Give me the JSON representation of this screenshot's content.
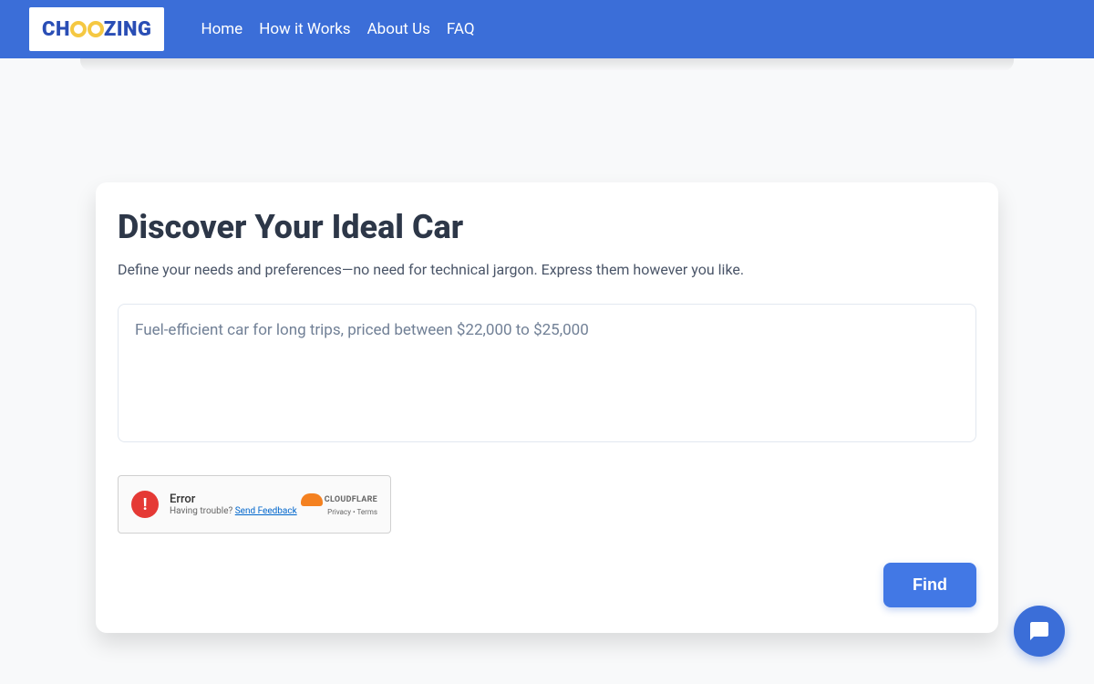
{
  "logo": {
    "part1": "CH",
    "part2": "ZING"
  },
  "nav": {
    "home": "Home",
    "how_it_works": "How it Works",
    "about_us": "About Us",
    "faq": "FAQ"
  },
  "card": {
    "title": "Discover Your Ideal Car",
    "subtitle": "Define your needs and preferences—no need for technical jargon. Express them however you like.",
    "placeholder": "Fuel-efficient car for long trips, priced between $22,000 to $25,000"
  },
  "captcha": {
    "error_label": "Error",
    "trouble_text": "Having trouble? ",
    "feedback_link": "Send Feedback",
    "brand": "CLOUDFLARE",
    "privacy": "Privacy",
    "separator": " • ",
    "terms": "Terms"
  },
  "find_button": "Find"
}
